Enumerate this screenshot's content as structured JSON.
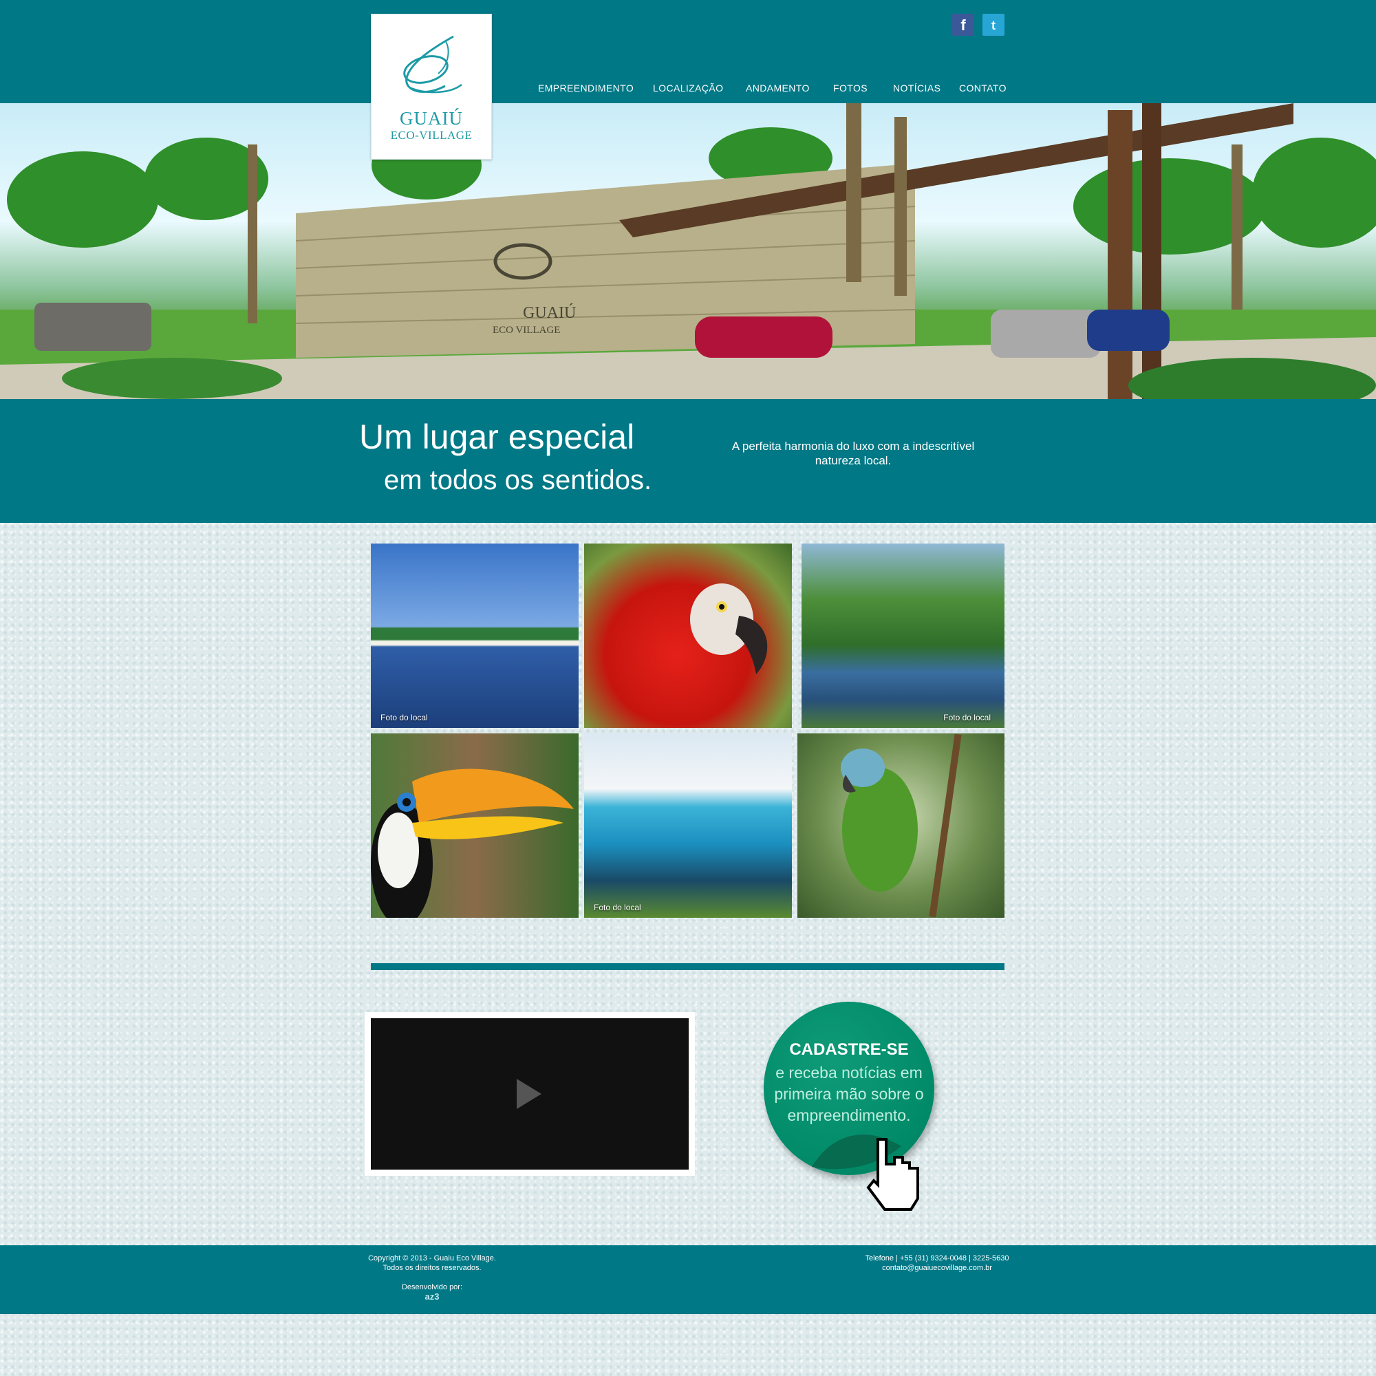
{
  "brand": {
    "name_line1": "GUAIÚ",
    "name_line2": "ECO-VILLAGE"
  },
  "social": {
    "facebook": "f",
    "twitter": "t"
  },
  "nav": {
    "items": [
      "EMPREENDIMENTO",
      "LOCALIZAÇÃO",
      "ANDAMENTO",
      "FOTOS",
      "NOTÍCIAS",
      "CONTATO"
    ]
  },
  "hero": {
    "sign_line1": "GUAIÚ",
    "sign_line2": "ECO VILLAGE"
  },
  "tagline": {
    "line1": "Um lugar especial",
    "line2": "em todos os sentidos.",
    "description": "A perfeita harmonia do luxo com a indescritível natureza local."
  },
  "gallery": {
    "photos": [
      {
        "caption": "Foto do local"
      },
      {
        "caption": ""
      },
      {
        "caption": "Foto do local"
      },
      {
        "caption": ""
      },
      {
        "caption": "Foto do local"
      },
      {
        "caption": ""
      }
    ]
  },
  "register": {
    "title": "CADASTRE-SE",
    "body": "e receba notícias em primeira mão sobre o empreendimento."
  },
  "footer": {
    "copyright_line1": "Copyright © 2013 - Guaiu Eco Village.",
    "copyright_line2": "Todos os direitos reservados.",
    "developed_by": "Desenvolvido por:",
    "developer_logo": "az3",
    "phone": "Telefone | +55 (31) 9324-0048 | 3225-5630",
    "email": "contato@guaiuecovillage.com.br"
  },
  "colors": {
    "primary": "#007886",
    "register_green": "#008a68",
    "background": "#dfeaec"
  }
}
